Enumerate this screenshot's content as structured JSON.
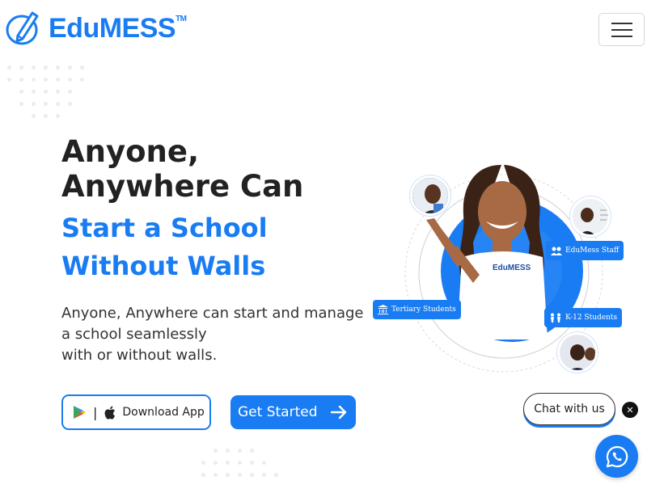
{
  "header": {
    "logo_text": "EduMESS",
    "logo_tm": "TM",
    "menu_icon": "hamburger-menu-icon"
  },
  "hero": {
    "headline_line1": "Anyone,",
    "headline_line2": "Anywhere Can",
    "accent_line1": "Start a School",
    "accent_line2": "Without Walls",
    "subtitle_line1": "Anyone, Anywhere can start and manage",
    "subtitle_line2": "a school seamlessly",
    "subtitle_line3": "with or without walls.",
    "download_label": "Download App",
    "download_separator": "|",
    "get_started_label": "Get Started"
  },
  "illustration": {
    "chip_staff": "EduMess Staff",
    "chip_tertiary": "Tertiary Students",
    "chip_k12": "K-12 Students",
    "shirt_logo": "EduMESS"
  },
  "chat": {
    "label": "Chat with us",
    "close_symbol": "✕"
  },
  "colors": {
    "brand": "#1a7cf2",
    "text": "#222222"
  }
}
